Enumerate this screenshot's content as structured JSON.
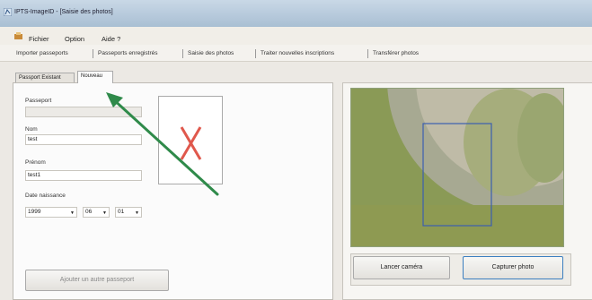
{
  "window": {
    "title": "IPTS-ImageID - [Saisie des photos]"
  },
  "menu": [
    "Fichier",
    "Option",
    "Aide ?"
  ],
  "toolbar": [
    "Importer passeports",
    "Passeports enregistrés",
    "Saisie des photos",
    "Traiter nouvelles inscriptions",
    "Transférer photos"
  ],
  "tabs": {
    "existing": "Passport Existant",
    "new": "Nouveau"
  },
  "form": {
    "passport_label": "Passeport",
    "passport_value": "",
    "nom_label": "Nom",
    "nom_value": "test",
    "prenom_label": "Prénom",
    "prenom_value": "test1",
    "birth_label": "Date naissance",
    "birth_year": "1999",
    "birth_month": "06",
    "birth_day": "01",
    "add_button": "Ajouter un autre passeport"
  },
  "camera": {
    "launch_button": "Lancer caméra",
    "capture_button": "Capturer photo"
  },
  "colors": {
    "arrow": "#2f8a4a",
    "error_cross": "#e0584c",
    "selection_box": "#3b5fb0"
  }
}
